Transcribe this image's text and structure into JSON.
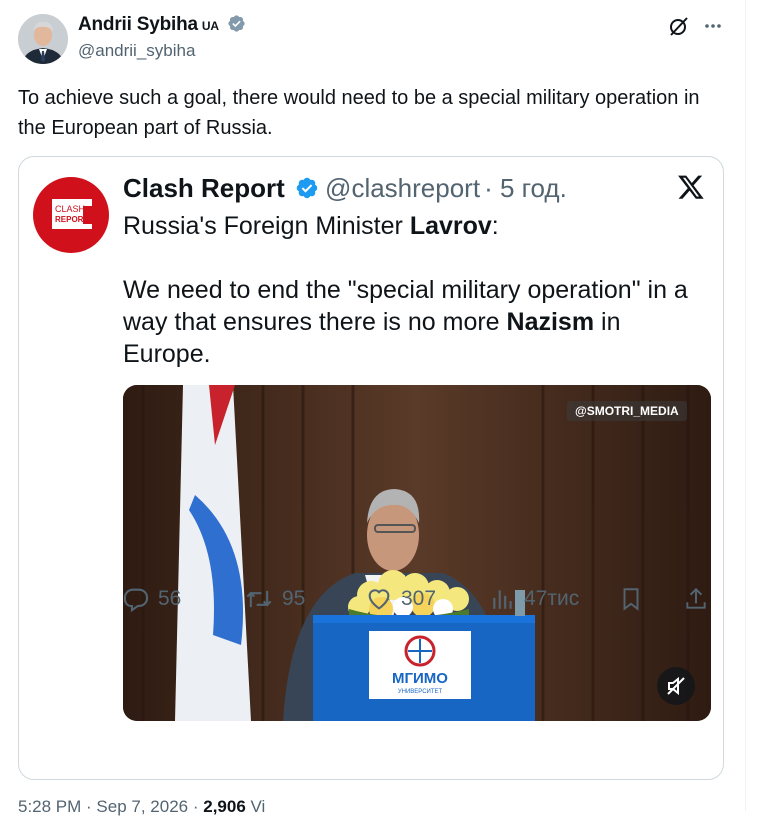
{
  "tweet": {
    "author_name": "Andrii Sybiha",
    "author_flag": "UA",
    "author_handle": "@andrii_sybiha",
    "text": "To achieve such a goal, there would need to be a special military operation in the European part of Russia."
  },
  "quoted": {
    "logo_line1": "CLASH",
    "logo_line2": "REPORT",
    "name": "Clash Report",
    "handle": "@clashreport",
    "time": "· 5 год.",
    "line1_prefix": "Russia's Foreign Minister ",
    "line1_bold": "Lavrov",
    "line1_suffix": ":",
    "line2_prefix": "We need to end the \"special military operation\" in a way that ensures there is no more ",
    "line2_bold": "Nazism",
    "line2_suffix": " in Europe.",
    "video_watermark": "@SMOTRI_MEDIA",
    "podium_logo_text": "МГИМО",
    "podium_logo_sub": "УНИВЕРСИТЕТ"
  },
  "actions": {
    "replies": "56",
    "reposts": "95",
    "likes": "307",
    "views": "47тис"
  },
  "footer": {
    "time": "5:28 PM · Sep 7, 2026 ·",
    "views_count": "2,906",
    "views_label": "Vi"
  },
  "colors": {
    "verified": "#1d9bf0",
    "brand_red": "#d0111b",
    "text_secondary": "#536471"
  }
}
